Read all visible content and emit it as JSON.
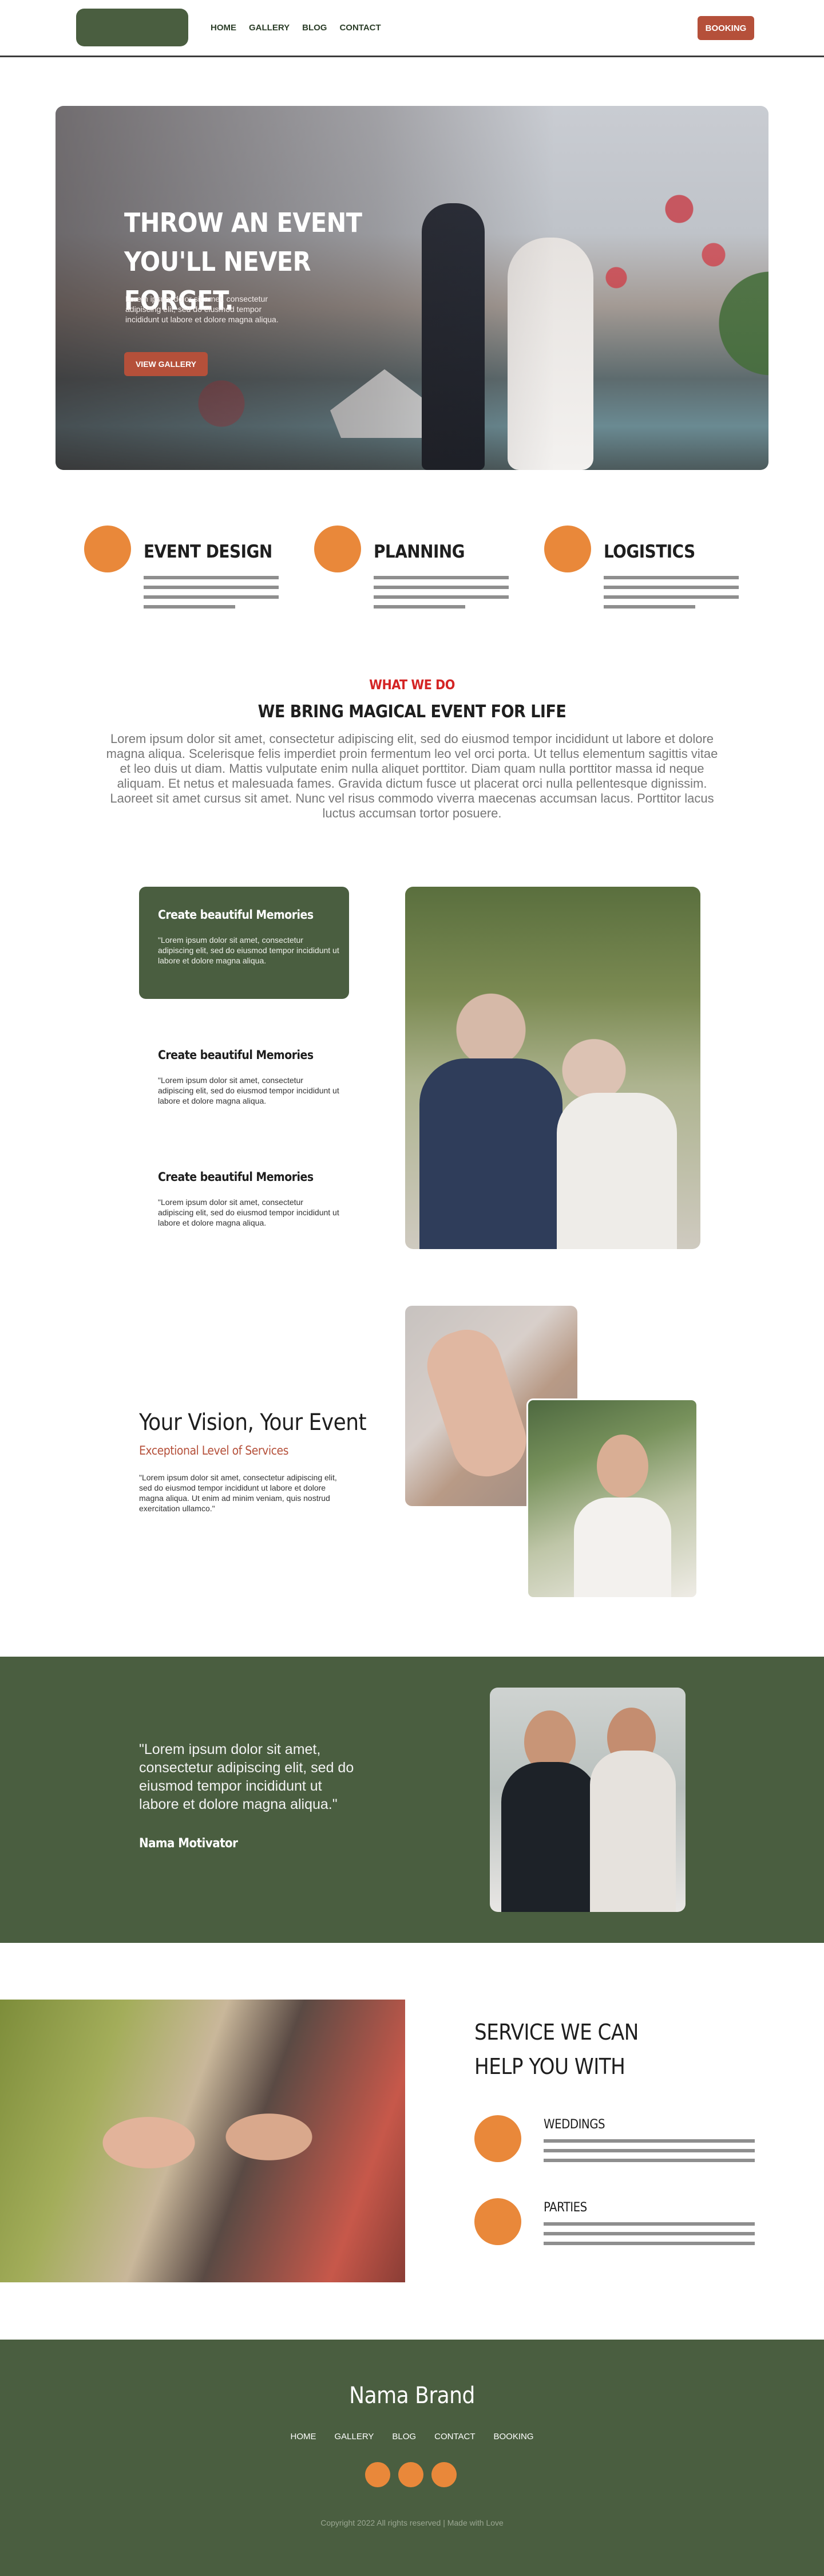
{
  "nav": {
    "links": [
      "HOME",
      "GALLERY",
      "BLOG",
      "CONTACT"
    ],
    "booking_label": "BOOKING"
  },
  "hero": {
    "title": "THROW AN EVENT YOU'LL NEVER FORGET.",
    "subtitle": "Lorem ipsum dolor sit amet, consectetur adipiscing elit, sed do eiusmod tempor incididunt ut labore et dolore magna aliqua.",
    "button_label": "VIEW GALLERY"
  },
  "features": [
    {
      "title": "EVENT DESIGN"
    },
    {
      "title": "PLANNING"
    },
    {
      "title": "LOGISTICS"
    }
  ],
  "what_we_do": {
    "kicker": "WHAT WE DO",
    "title": "WE BRING MAGICAL EVENT FOR LIFE",
    "body": "Lorem ipsum dolor sit amet, consectetur adipiscing elit, sed do eiusmod tempor incididunt ut labore et dolore magna aliqua. Scelerisque felis imperdiet proin fermentum leo vel orci porta. Ut tellus elementum sagittis vitae et leo duis ut diam. Mattis vulputate enim nulla aliquet porttitor. Diam quam nulla porttitor massa id neque aliquam. Et netus et malesuada fames. Gravida dictum fusce ut placerat orci nulla pellentesque dignissim. Laoreet sit amet cursus sit amet. Nunc vel risus commodo viverra maecenas accumsan lacus. Porttitor lacus luctus accumsan tortor posuere."
  },
  "memories": [
    {
      "title": "Create beautiful Memories",
      "text": "\"Lorem ipsum dolor sit amet, consectetur adipiscing elit, sed do eiusmod tempor incididunt ut labore et dolore magna aliqua."
    },
    {
      "title": "Create beautiful Memories",
      "text": "\"Lorem ipsum dolor sit amet, consectetur adipiscing elit, sed do eiusmod tempor incididunt ut labore et dolore magna aliqua."
    },
    {
      "title": "Create beautiful Memories",
      "text": "\"Lorem ipsum dolor sit amet, consectetur adipiscing elit, sed do eiusmod tempor incididunt ut labore et dolore magna aliqua."
    }
  ],
  "vision": {
    "title": "Your Vision, Your Event",
    "subtitle": "Exceptional Level of Services",
    "text": "\"Lorem ipsum dolor sit amet, consectetur adipiscing elit, sed do eiusmod tempor incididunt ut labore et dolore magna aliqua. Ut enim ad minim veniam, quis nostrud exercitation ullamco.\""
  },
  "quote": {
    "text": "\"Lorem ipsum dolor sit amet, consectetur adipiscing elit, sed do eiusmod tempor incididunt ut labore et dolore magna aliqua.\"",
    "author": "Nama Motivator"
  },
  "services": {
    "title": "SERVICE WE CAN HELP YOU WITH",
    "items": [
      "WEDDINGS",
      "PARTIES"
    ]
  },
  "footer": {
    "brand": "Nama Brand",
    "links": [
      "HOME",
      "GALLERY",
      "BLOG",
      "CONTACT",
      "BOOKING"
    ],
    "copyright": "Copyright 2022 All rights reserved | Made with Love"
  },
  "colors": {
    "brand_green": "#4a5e40",
    "accent_orange": "#e9883a",
    "button_red": "#b5503a",
    "kicker_red": "#d42525"
  }
}
